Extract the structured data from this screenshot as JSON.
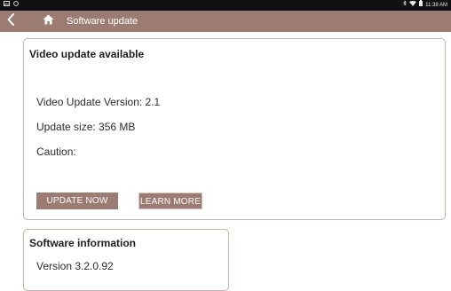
{
  "status_bar": {
    "left_icons": [
      "gallery-icon",
      "record-icon"
    ],
    "right_icons": [
      "bluetooth-icon",
      "wifi-icon",
      "battery-icon"
    ],
    "time": "11:38 AM"
  },
  "toolbar": {
    "title": "Software update",
    "back_icon": "chevron-left-icon",
    "home_icon": "home-icon",
    "background": "#9b7b72"
  },
  "update_card": {
    "heading": "Video update available",
    "version_line": "Video Update Version: 2.1",
    "size_line": "Update size: 356 MB",
    "caution_line": "Caution:",
    "update_button": "UPDATE NOW",
    "learn_button": "LEARN MORE"
  },
  "info_card": {
    "heading": "Software information",
    "version_line": "Version 3.2.0.92"
  },
  "colors": {
    "accent": "#9b7b72",
    "card_border": "#c9b3ad",
    "status_bar": "#111111"
  }
}
